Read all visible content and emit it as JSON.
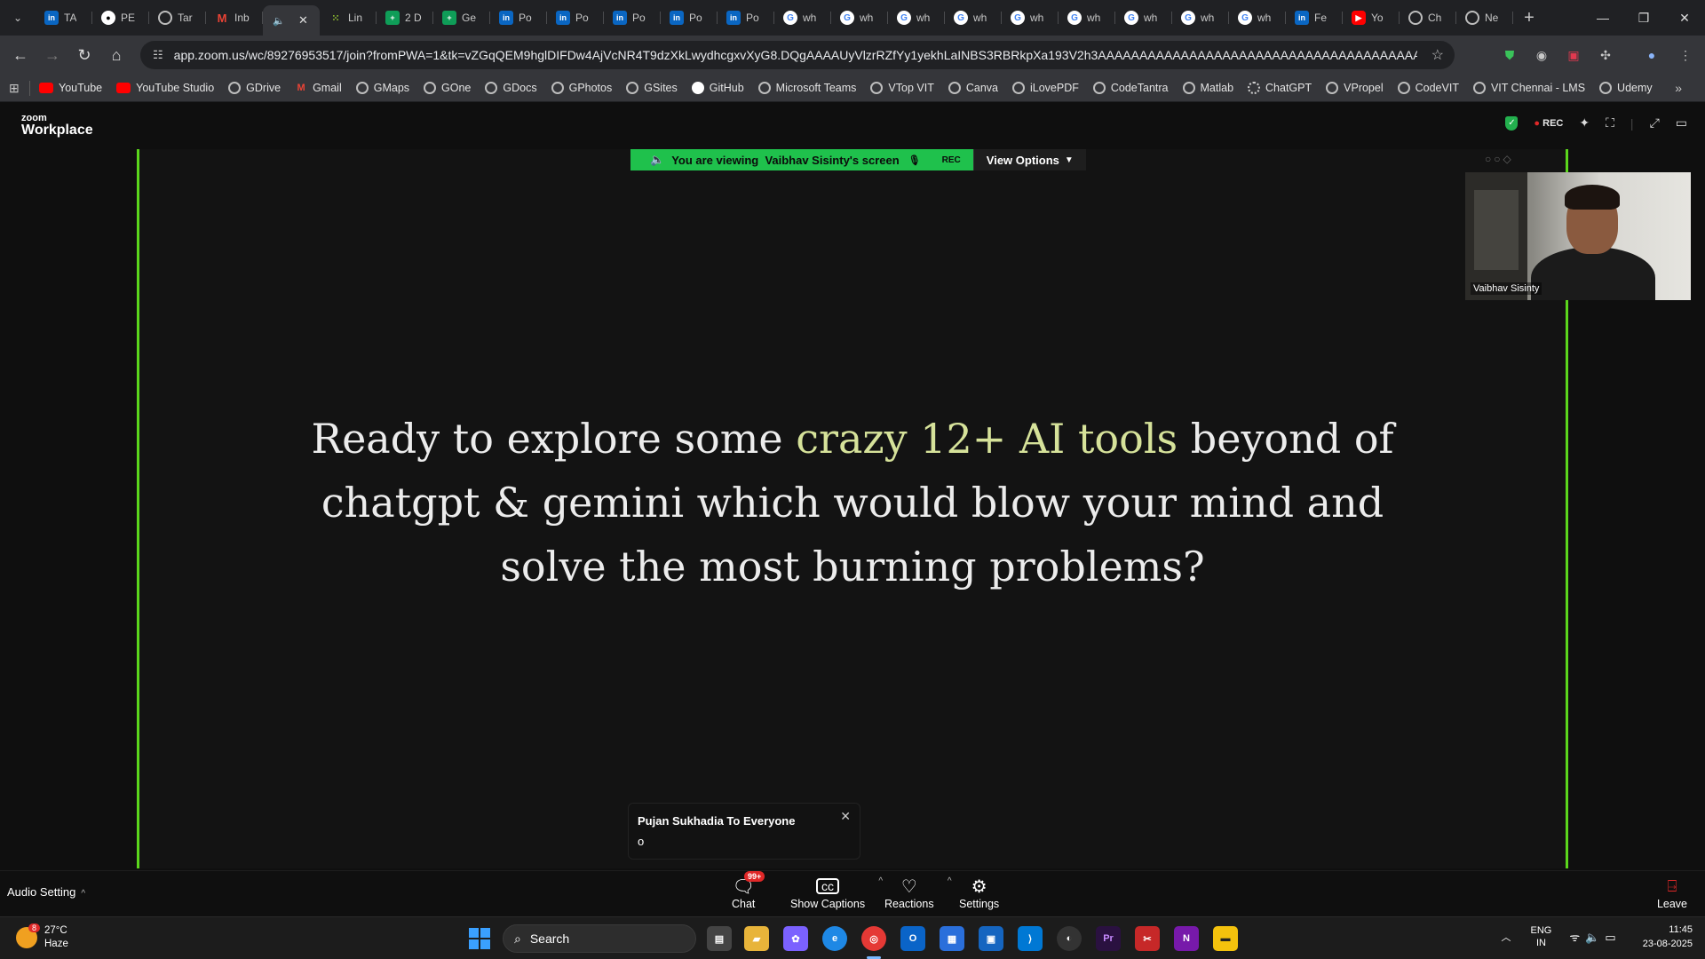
{
  "browser": {
    "tabs": [
      {
        "label": "TA",
        "icon": "linkedin"
      },
      {
        "label": "PE",
        "icon": "github"
      },
      {
        "label": "Tar",
        "icon": "web"
      },
      {
        "label": "Inb",
        "icon": "gmail"
      },
      {
        "label": "",
        "icon": "speaker",
        "active": true
      },
      {
        "label": "Lin",
        "icon": "linear"
      },
      {
        "label": "2 D",
        "icon": "sheets"
      },
      {
        "label": "Ge",
        "icon": "sheets"
      },
      {
        "label": "Po",
        "icon": "linkedin"
      },
      {
        "label": "Po",
        "icon": "linkedin"
      },
      {
        "label": "Po",
        "icon": "linkedin"
      },
      {
        "label": "Po",
        "icon": "linkedin"
      },
      {
        "label": "Po",
        "icon": "linkedin"
      },
      {
        "label": "wh",
        "icon": "google"
      },
      {
        "label": "wh",
        "icon": "google"
      },
      {
        "label": "wh",
        "icon": "google"
      },
      {
        "label": "wh",
        "icon": "google"
      },
      {
        "label": "wh",
        "icon": "google"
      },
      {
        "label": "wh",
        "icon": "google"
      },
      {
        "label": "wh",
        "icon": "google"
      },
      {
        "label": "wh",
        "icon": "google"
      },
      {
        "label": "wh",
        "icon": "google"
      },
      {
        "label": "Fe",
        "icon": "linkedin"
      },
      {
        "label": "Yo",
        "icon": "youtube"
      },
      {
        "label": "Ch",
        "icon": "web"
      },
      {
        "label": "Ne",
        "icon": "web"
      }
    ],
    "url": "app.zoom.us/wc/89276953517/join?fromPWA=1&tk=vZGqQEM9hglDIFDw4AjVcNR4T9dzXkLwydhcgxvXyG8.DQgAAAAUyVlzrRZfYy1yekhLaINBS3RBRkpXa193V2h3AAAAAAAAAAAAAAAAAAAAAAAAAAAAAAAAAAAAAAAA&_x_zm_r...",
    "bookmarks": [
      "YouTube",
      "YouTube Studio",
      "GDrive",
      "Gmail",
      "GMaps",
      "GOne",
      "GDocs",
      "GPhotos",
      "GSites",
      "GitHub",
      "Microsoft Teams",
      "VTop VIT",
      "Canva",
      "iLovePDF",
      "CodeTantra",
      "Matlab",
      "ChatGPT",
      "VPropel",
      "CodeVIT",
      "VIT Chennai - LMS",
      "Udemy"
    ]
  },
  "zoom": {
    "logo_small": "zoom",
    "logo_big": "Workplace",
    "rec_label": "REC",
    "banner": {
      "viewing_prefix": "You are viewing",
      "viewing_name": "Vaibhav Sisinty's screen",
      "rec_label": "REC",
      "view_options": "View Options"
    },
    "slide": {
      "part1": "Ready to explore some ",
      "highlight": "crazy 12+ AI tools",
      "part2": " beyond of chatgpt & gemini which would blow your mind and solve the most burning problems?"
    },
    "self_view_name": "Vaibhav Sisinty",
    "chat_toast": {
      "from": "Pujan Sukhadia To Everyone",
      "message": "o"
    },
    "controls": {
      "audio_setting": "Audio Setting",
      "chat": "Chat",
      "chat_badge": "99+",
      "captions": "Show Captions",
      "reactions": "Reactions",
      "settings": "Settings",
      "leave": "Leave"
    },
    "accent_color": "#5bd61c"
  },
  "taskbar": {
    "weather_temp": "27°C",
    "weather_desc": "Haze",
    "weather_badge": "8",
    "search_label": "Search",
    "lang_line1": "ENG",
    "lang_line2": "IN",
    "time": "11:45",
    "date": "23-08-2025"
  }
}
